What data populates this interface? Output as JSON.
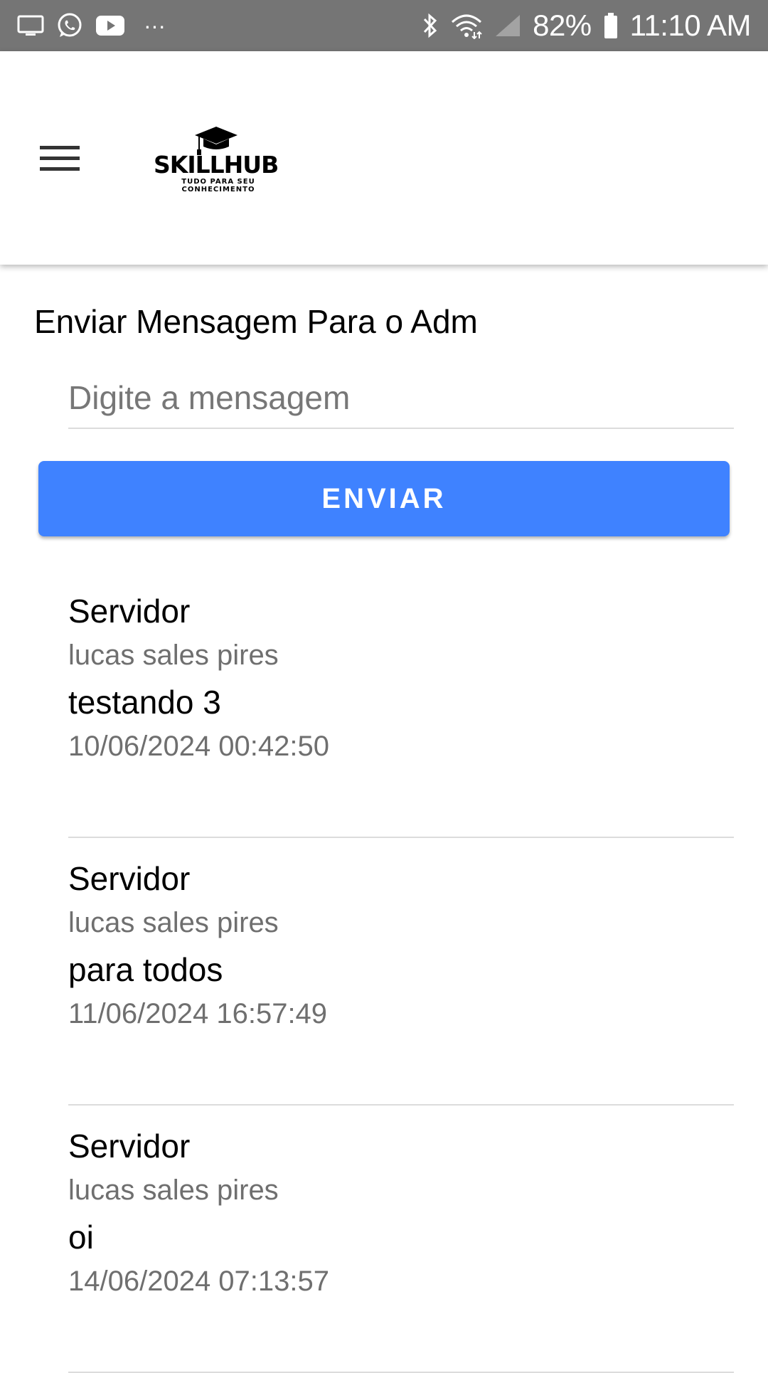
{
  "status_bar": {
    "left_icons": [
      "screen-icon",
      "whatsapp-icon",
      "youtube-icon",
      "more-dots-icon"
    ],
    "more_dots": "···",
    "battery": "82%",
    "time": "11:10 AM"
  },
  "header": {
    "logo_text": "SKILLHUB",
    "logo_tagline_1": "TUDO PARA SEU",
    "logo_tagline_2": "CONHECIMENTO"
  },
  "form": {
    "title": "Enviar Mensagem Para o Adm",
    "input_placeholder": "Digite a mensagem",
    "input_value": "",
    "send_label": "ENVIAR"
  },
  "messages": [
    {
      "sender": "Servidor",
      "user": "lucas sales pires",
      "text": "testando 3",
      "timestamp": "10/06/2024 00:42:50"
    },
    {
      "sender": "Servidor",
      "user": "lucas sales pires",
      "text": "para todos",
      "timestamp": "11/06/2024 16:57:49"
    },
    {
      "sender": "Servidor",
      "user": "lucas sales pires",
      "text": "oi",
      "timestamp": "14/06/2024 07:13:57"
    }
  ],
  "colors": {
    "status_bar": "#757575",
    "accent": "#3f82ff",
    "divider": "#dcdcdc",
    "secondary_text": "#6f6f6f"
  }
}
